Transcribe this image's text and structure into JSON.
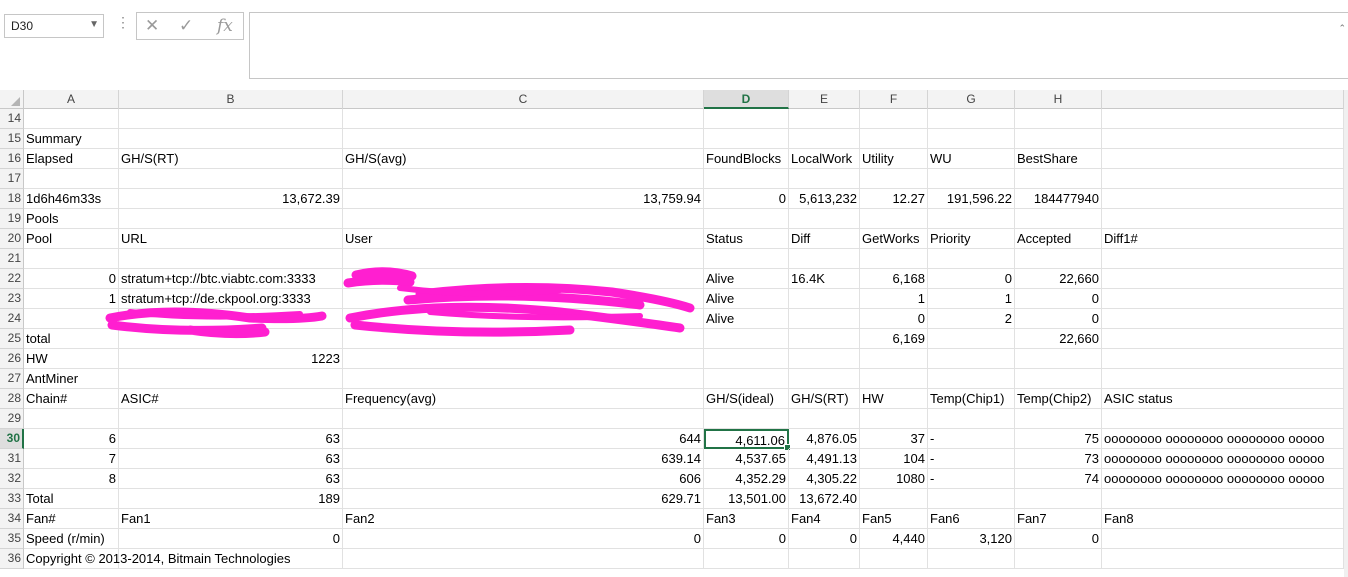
{
  "namebox": {
    "value": "D30"
  },
  "formula_bar": {
    "value": "",
    "icons": [
      "cancel-icon",
      "enter-icon",
      "fx-icon"
    ],
    "fx_label": "fx"
  },
  "columns": [
    "A",
    "B",
    "C",
    "D",
    "E",
    "F",
    "G",
    "H",
    ""
  ],
  "selected_cell": "D30",
  "accent_color": "#217346",
  "redaction_color": "#ff1fd0",
  "rows": [
    {
      "num": "14",
      "cells": [
        "",
        "",
        "",
        "",
        "",
        "",
        "",
        "",
        ""
      ]
    },
    {
      "num": "15",
      "cells": [
        "Summary",
        "",
        "",
        "",
        "",
        "",
        "",
        "",
        ""
      ]
    },
    {
      "num": "16",
      "cells": [
        "Elapsed",
        "GH/S(RT)",
        "GH/S(avg)",
        "FoundBlocks",
        "LocalWork",
        "Utility",
        "WU",
        "BestShare",
        ""
      ]
    },
    {
      "num": "17",
      "cells": [
        "",
        "",
        "",
        "",
        "",
        "",
        "",
        "",
        ""
      ]
    },
    {
      "num": "18",
      "cells": [
        "1d6h46m33s",
        "13,672.39",
        "13,759.94",
        "0",
        "5,613,232",
        "12.27",
        "191,596.22",
        "184477940",
        ""
      ]
    },
    {
      "num": "19",
      "cells": [
        "Pools",
        "",
        "",
        "",
        "",
        "",
        "",
        "",
        ""
      ]
    },
    {
      "num": "20",
      "cells": [
        "Pool",
        "URL",
        "User",
        "Status",
        "Diff",
        "GetWorks",
        "Priority",
        "Accepted",
        "Diff1#"
      ]
    },
    {
      "num": "21",
      "cells": [
        "",
        "",
        "",
        "",
        "",
        "",
        "",
        "",
        ""
      ]
    },
    {
      "num": "22",
      "cells": [
        "0",
        "stratum+tcp://btc.viabtc.com:3333",
        "",
        "Alive",
        "16.4K",
        "6,168",
        "0",
        "22,660",
        ""
      ]
    },
    {
      "num": "23",
      "cells": [
        "1",
        "stratum+tcp://de.ckpool.org:3333",
        "",
        "Alive",
        "",
        "1",
        "1",
        "0",
        ""
      ]
    },
    {
      "num": "24",
      "cells": [
        "",
        "",
        "",
        "Alive",
        "",
        "0",
        "2",
        "0",
        ""
      ]
    },
    {
      "num": "25",
      "cells": [
        "total",
        "",
        "",
        "",
        "",
        "6,169",
        "",
        "22,660",
        ""
      ]
    },
    {
      "num": "26",
      "cells": [
        "HW",
        "1223",
        "",
        "",
        "",
        "",
        "",
        "",
        ""
      ]
    },
    {
      "num": "27",
      "cells": [
        "AntMiner",
        "",
        "",
        "",
        "",
        "",
        "",
        "",
        ""
      ]
    },
    {
      "num": "28",
      "cells": [
        "Chain#",
        "ASIC#",
        "Frequency(avg)",
        "GH/S(ideal)",
        "GH/S(RT)",
        "HW",
        "Temp(Chip1)",
        "Temp(Chip2)",
        "ASIC status"
      ]
    },
    {
      "num": "29",
      "cells": [
        "",
        "",
        "",
        "",
        "",
        "",
        "",
        "",
        ""
      ]
    },
    {
      "num": "30",
      "cells": [
        "6",
        "63",
        "644",
        "4,611.06",
        "4,876.05",
        "37",
        "-",
        "75",
        "oooooooo oooooooo oooooooo ooooo"
      ]
    },
    {
      "num": "31",
      "cells": [
        "7",
        "63",
        "639.14",
        "4,537.65",
        "4,491.13",
        "104",
        "-",
        "73",
        "oooooooo oooooooo oooooooo ooooo"
      ]
    },
    {
      "num": "32",
      "cells": [
        "8",
        "63",
        "606",
        "4,352.29",
        "4,305.22",
        "1080",
        "-",
        "74",
        "oooooooo oooooooo oooooooo ooooo"
      ]
    },
    {
      "num": "33",
      "cells": [
        "Total",
        "189",
        "629.71",
        "13,501.00",
        "13,672.40",
        "",
        "",
        "",
        ""
      ]
    },
    {
      "num": "34",
      "cells": [
        "Fan#",
        "Fan1",
        "Fan2",
        "Fan3",
        "Fan4",
        "Fan5",
        "Fan6",
        "Fan7",
        "Fan8"
      ]
    },
    {
      "num": "35",
      "cells": [
        "Speed (r/min)",
        "0",
        "0",
        "0",
        "0",
        "4,440",
        "3,120",
        "0",
        ""
      ]
    },
    {
      "num": "36",
      "cells": [
        "Copyright © 2013-2014, Bitmain Technologies",
        "",
        "",
        "",
        "",
        "",
        "",
        "",
        ""
      ]
    }
  ]
}
